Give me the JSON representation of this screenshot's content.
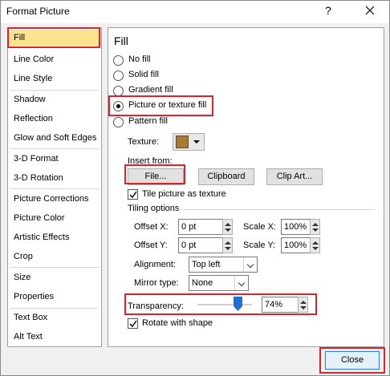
{
  "window": {
    "title": "Format Picture",
    "help": "?"
  },
  "sidebar": {
    "items": [
      {
        "label": "Fill"
      },
      {
        "label": "Line Color"
      },
      {
        "label": "Line Style"
      },
      {
        "label": "Shadow"
      },
      {
        "label": "Reflection"
      },
      {
        "label": "Glow and Soft Edges"
      },
      {
        "label": "3-D Format"
      },
      {
        "label": "3-D Rotation"
      },
      {
        "label": "Picture Corrections"
      },
      {
        "label": "Picture Color"
      },
      {
        "label": "Artistic Effects"
      },
      {
        "label": "Crop"
      },
      {
        "label": "Size"
      },
      {
        "label": "Properties"
      },
      {
        "label": "Text Box"
      },
      {
        "label": "Alt Text"
      }
    ],
    "selected": "Fill"
  },
  "fill": {
    "heading": "Fill",
    "options": {
      "no_fill": "No fill",
      "solid_fill": "Solid fill",
      "gradient_fill": "Gradient fill",
      "picture_texture_fill": "Picture or texture fill",
      "pattern_fill": "Pattern fill"
    },
    "selected_option": "Picture or texture fill",
    "texture_label": "Texture:",
    "insert_from_label": "Insert from:",
    "file_button": "File...",
    "clipboard_button": "Clipboard",
    "clipart_button": "Clip Art...",
    "tile_checkbox": "Tile picture as texture",
    "tile_checked": true,
    "tiling_options_label": "Tiling options",
    "offset_x_label": "Offset X:",
    "offset_x_value": "0 pt",
    "scale_x_label": "Scale X:",
    "scale_x_value": "100%",
    "offset_y_label": "Offset Y:",
    "offset_y_value": "0 pt",
    "scale_y_label": "Scale Y:",
    "scale_y_value": "100%",
    "alignment_label": "Alignment:",
    "alignment_value": "Top left",
    "mirror_label": "Mirror type:",
    "mirror_value": "None",
    "transparency_label": "Transparency:",
    "transparency_value": "74%",
    "transparency_level": 0.74,
    "rotate_checkbox": "Rotate with shape",
    "rotate_checked": true
  },
  "footer": {
    "close_button": "Close"
  },
  "colors": {
    "highlight_red": "#d9232d",
    "selected_bg": "#fbe28c",
    "slider_thumb": "#1f6fd0"
  }
}
